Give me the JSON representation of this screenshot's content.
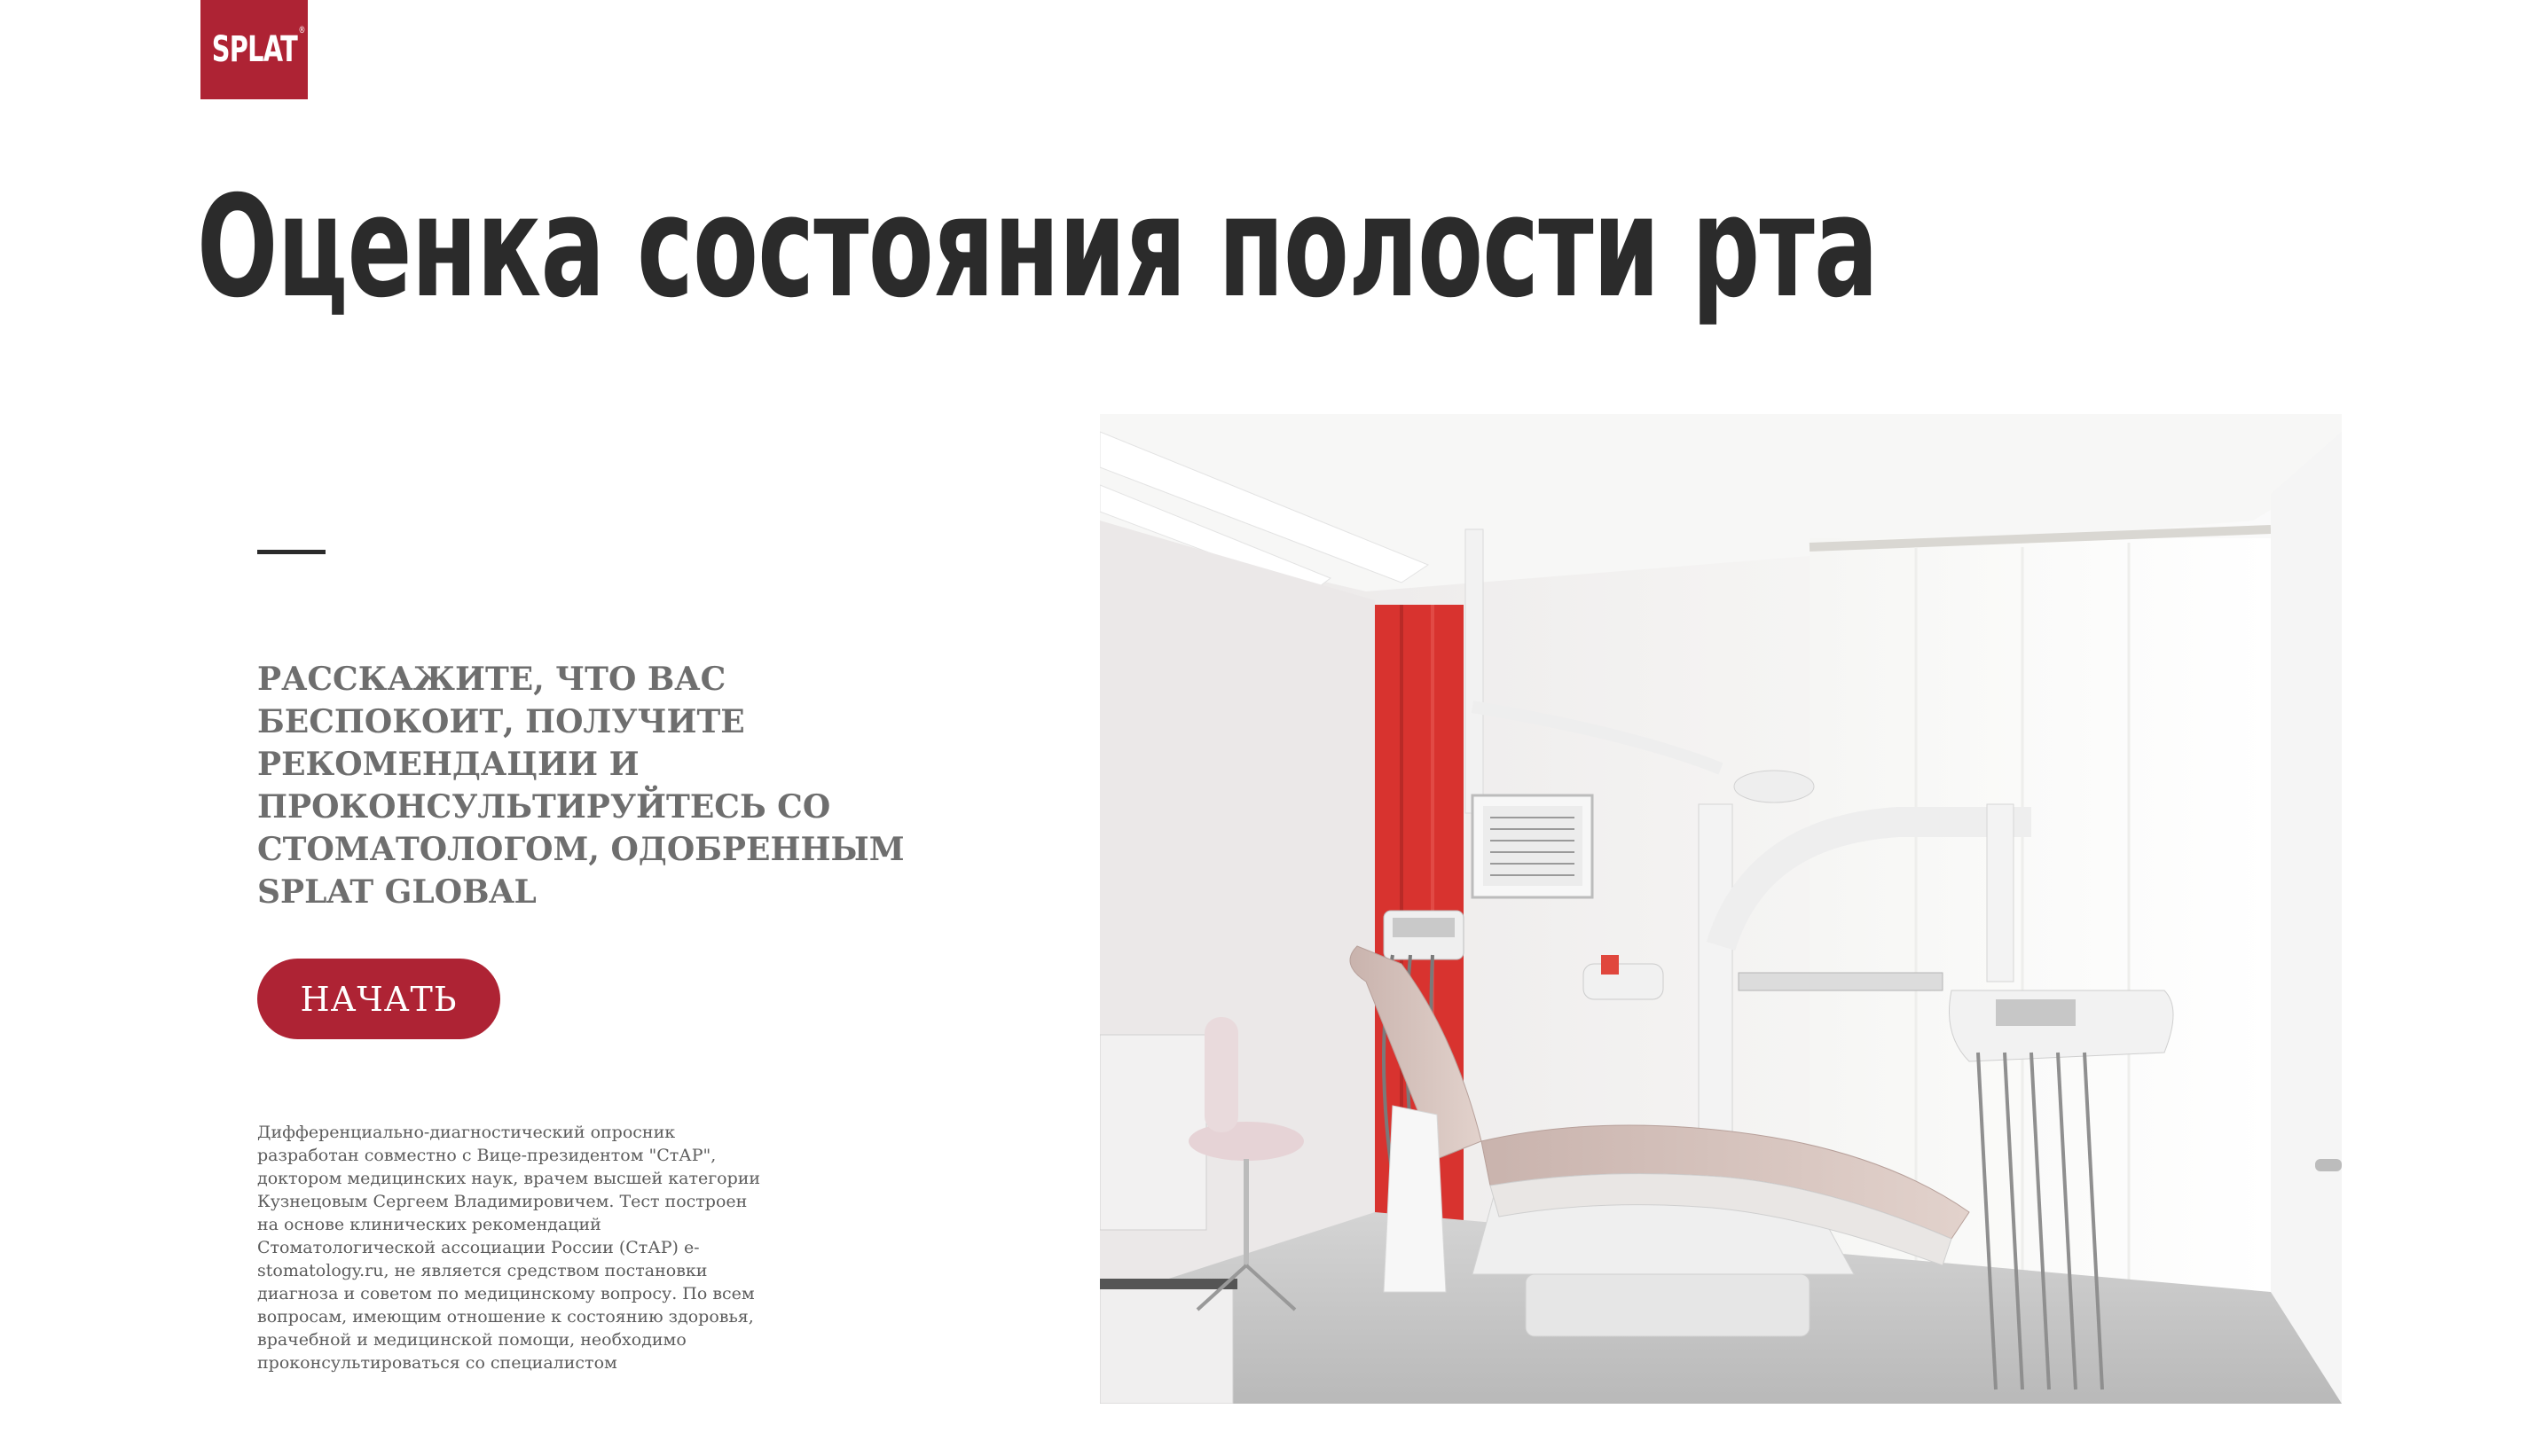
{
  "header": {
    "logo_text": "SPLAT",
    "logo_mark": "®"
  },
  "main": {
    "title": "Оценка состояния полости рта",
    "tagline": "РАССКАЖИТЕ, ЧТО ВАС БЕСПОКОИТ, ПОЛУЧИТЕ РЕКОМЕНДАЦИИ И ПРОКОНСУЛЬТИРУЙТЕСЬ СО СТОМАТОЛОГОМ, ОДОБРЕННЫМ SPLAT GLOBAL",
    "start_button_label": "НАЧАТЬ",
    "disclaimer": "Дифференциально-диагностический опросник разработан совместно с Вице-президентом \"СтАР\", доктором медицинских наук, врачем высшей категории Кузнецовым Сергеем Владимировичем. Тест построен на основе клинических рекомендаций Стоматологической ассоциации России (СтАР) e-stomatology.ru, не является средством постановки диагноза и советом по медицинскому вопросу. По всем вопросам, имеющим отношение к состоянию здоровья, врачебной и медицинской помощи, необходимо проконсультироваться со специалистом"
  },
  "colors": {
    "brand": "#ae2334",
    "heading": "#2b2b2b",
    "tagline": "#6e6e6e",
    "disclaimer": "#5c5c5c"
  },
  "hero_image": {
    "icon": "dental-office-photo"
  }
}
